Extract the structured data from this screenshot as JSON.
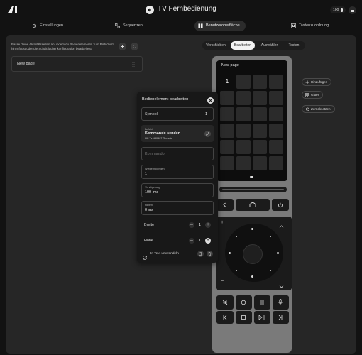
{
  "header": {
    "title": "TV Fernbedienung",
    "battery": "100"
  },
  "nav": {
    "tabs": [
      {
        "label": "Einstellungen",
        "icon": "gear-icon"
      },
      {
        "label": "Sequenzen",
        "icon": "sequence-icon"
      },
      {
        "label": "Benutzeroberfläche",
        "icon": "layout-icon",
        "active": true
      },
      {
        "label": "Tastenzuordnung",
        "icon": "keymap-icon"
      }
    ]
  },
  "editor": {
    "hint": "Passe deine Aktivitätsseiten an, indem du Bedienelemente zum Bildschirm hinzufügst oder die Schaltflächenkonfiguration bearbeitest.",
    "page_name": "New page",
    "modes": [
      "Verschieben",
      "Bearbeiten",
      "Auswählen",
      "Testen"
    ],
    "active_mode": "Bearbeiten"
  },
  "side_buttons": {
    "add": "Hinzufügen",
    "grid": "Gitter",
    "reset": "Zurücksetzen"
  },
  "remote": {
    "screen_title": "New page",
    "first_cell": "1"
  },
  "modal": {
    "title": "Bedienelement bearbeiten",
    "symbol_label": "Symbol",
    "symbol_value": "1",
    "command_small": "Befehl",
    "command_value": "Kommando senden",
    "command_detail": "HC Tv 430607 Remote",
    "command_placeholder": "Kommando",
    "repeat_label": "Wiederholungen",
    "repeat_value": "1",
    "delay_label": "Verzögerung",
    "delay_value": "100  ms",
    "hold_label": "Halten",
    "hold_value": "0 ms",
    "width_label": "Breite",
    "width_value": "1",
    "height_label": "Höhe",
    "height_value": "1",
    "convert_label": "In Text umwandeln"
  },
  "colors": {
    "background": "#121212",
    "panel": "#262626",
    "remote_body": "#7a7a7a",
    "accent": "#f2f2f2"
  }
}
